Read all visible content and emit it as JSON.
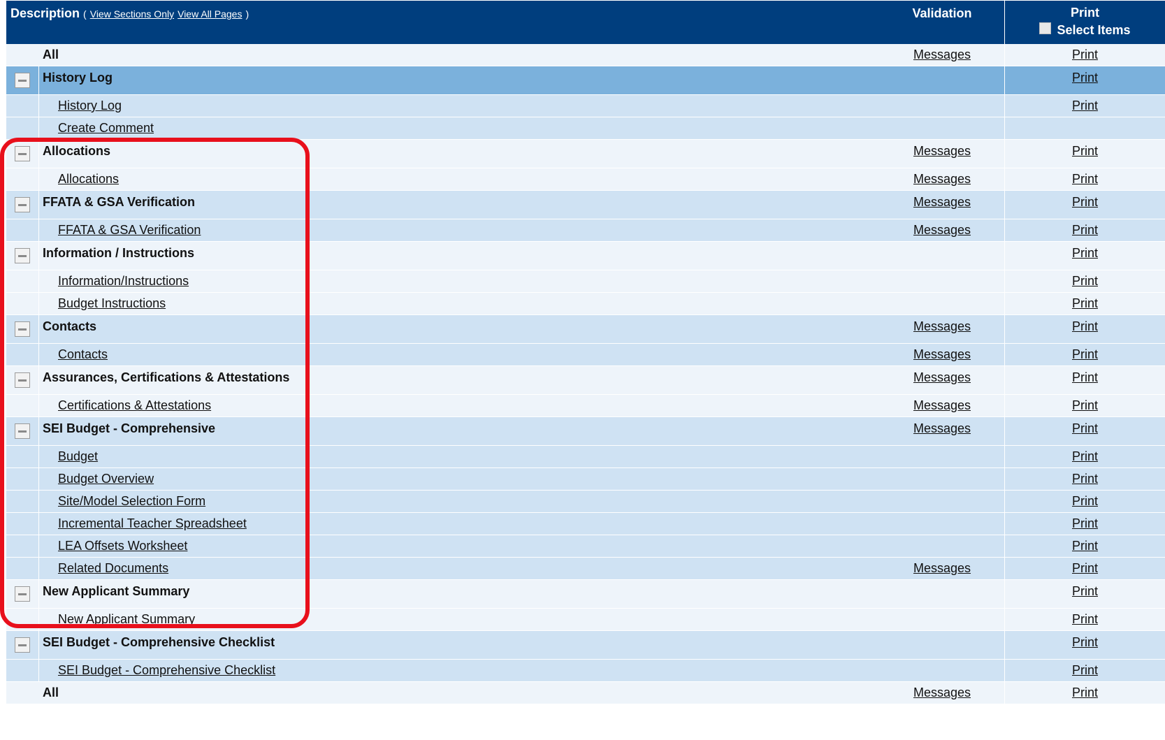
{
  "header": {
    "description": "Description",
    "open_paren": "(",
    "view_sections_only": "View Sections Only",
    "view_all_pages": "View All Pages",
    "close_paren": ")",
    "validation": "Validation",
    "print": "Print",
    "select_items": "Select Items"
  },
  "labels": {
    "messages": "Messages",
    "print": "Print"
  },
  "rows": [
    {
      "type": "all",
      "label": "All",
      "messages": "Messages",
      "print": "Print"
    },
    {
      "type": "section",
      "label": "History Log",
      "messages": "",
      "print": "Print"
    },
    {
      "type": "sub",
      "label": "History Log",
      "messages": "",
      "print": "Print"
    },
    {
      "type": "sub",
      "label": "Create Comment",
      "messages": "",
      "print": ""
    },
    {
      "type": "section",
      "label": "Allocations",
      "messages": "Messages",
      "print": "Print"
    },
    {
      "type": "sub",
      "label": "Allocations",
      "messages": "Messages",
      "print": "Print"
    },
    {
      "type": "section",
      "label": "FFATA & GSA Verification",
      "messages": "Messages",
      "print": "Print"
    },
    {
      "type": "sub",
      "label": "FFATA & GSA Verification",
      "messages": "Messages",
      "print": "Print"
    },
    {
      "type": "section",
      "label": "Information / Instructions",
      "messages": "",
      "print": "Print"
    },
    {
      "type": "sub",
      "label": "Information/Instructions",
      "messages": "",
      "print": "Print"
    },
    {
      "type": "sub",
      "label": "Budget Instructions",
      "messages": "",
      "print": "Print"
    },
    {
      "type": "section",
      "label": "Contacts",
      "messages": "Messages",
      "print": "Print"
    },
    {
      "type": "sub",
      "label": "Contacts",
      "messages": "Messages",
      "print": "Print"
    },
    {
      "type": "section",
      "label": "Assurances, Certifications & Attestations",
      "messages": "Messages",
      "print": "Print"
    },
    {
      "type": "sub",
      "label": "Certifications & Attestations",
      "messages": "Messages",
      "print": "Print"
    },
    {
      "type": "section",
      "label": "SEI Budget - Comprehensive",
      "messages": "Messages",
      "print": "Print"
    },
    {
      "type": "sub",
      "label": "Budget",
      "messages": "",
      "print": "Print"
    },
    {
      "type": "sub",
      "label": "Budget Overview",
      "messages": "",
      "print": "Print"
    },
    {
      "type": "sub",
      "label": "Site/Model Selection Form",
      "messages": "",
      "print": "Print"
    },
    {
      "type": "sub",
      "label": "Incremental Teacher Spreadsheet",
      "messages": "",
      "print": "Print"
    },
    {
      "type": "sub",
      "label": "LEA Offsets Worksheet",
      "messages": "",
      "print": "Print"
    },
    {
      "type": "sub",
      "label": "Related Documents",
      "messages": "Messages",
      "print": "Print"
    },
    {
      "type": "section",
      "label": "New Applicant Summary",
      "messages": "",
      "print": "Print"
    },
    {
      "type": "sub",
      "label": "New Applicant Summary",
      "messages": "",
      "print": "Print"
    },
    {
      "type": "section",
      "label": "SEI Budget - Comprehensive Checklist",
      "messages": "",
      "print": "Print"
    },
    {
      "type": "sub",
      "label": "SEI Budget - Comprehensive Checklist",
      "messages": "",
      "print": "Print"
    },
    {
      "type": "all",
      "label": "All",
      "messages": "Messages",
      "print": "Print"
    }
  ],
  "colors": {
    "header_bg": "#003e7e",
    "row_light": "#eef4fa",
    "row_mid": "#cfe2f3",
    "row_selected": "#7bb1dc",
    "highlight_border": "#e8101c"
  }
}
